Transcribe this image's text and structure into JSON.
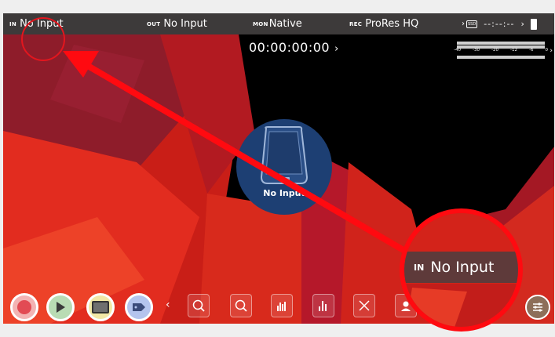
{
  "status_bar": {
    "in_tag": "IN",
    "in_value": "No Input",
    "out_tag": "OUT",
    "out_value": "No Input",
    "mon_tag": "MON",
    "mon_value": "Native",
    "rec_tag": "REC",
    "rec_value": "ProRes HQ",
    "storage_label": "SSD",
    "time_remaining": "--:--:--"
  },
  "timecode": "00:00:00:00",
  "audio_meter": {
    "scale": [
      "-40",
      "-30",
      "-20",
      "-12",
      "-6",
      "0"
    ]
  },
  "no_input_message": "No Input",
  "toolbar": {
    "buttons": [
      "record-button",
      "play-button",
      "monitor-mode-button",
      "tag-button"
    ],
    "tools": [
      "zoom-1to1-icon",
      "zoom-2x-icon",
      "waveform-icon",
      "vectorscope-icon",
      "focus-peaking-icon",
      "false-color-icon"
    ]
  },
  "callout": {
    "tag": "IN",
    "value": "No Input"
  },
  "colors": {
    "status_bar_bg": "#3d3a3a",
    "annotation_red": "#ff0a10",
    "no_input_disc": "#1d3f73"
  }
}
